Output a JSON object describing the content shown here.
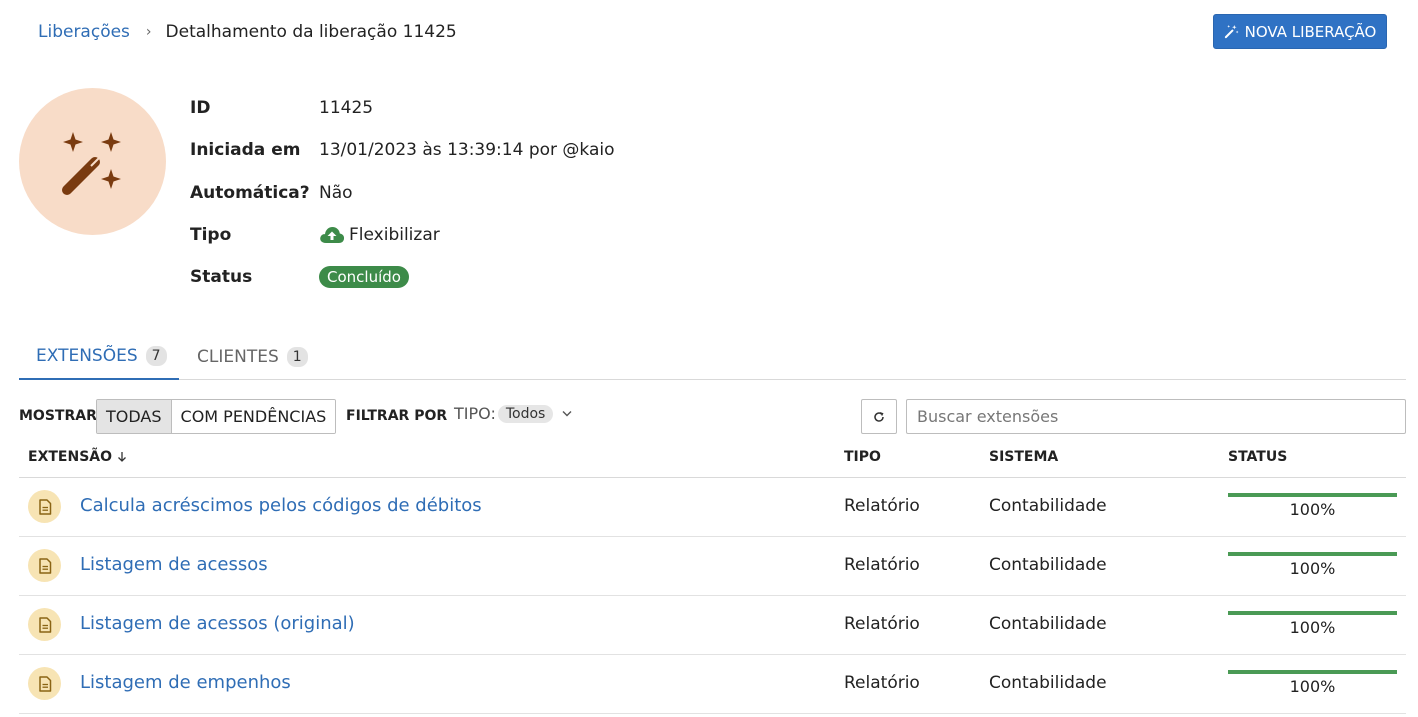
{
  "breadcrumb": {
    "parent": "Liberações",
    "separator": "›",
    "current": "Detalhamento da liberação 11425"
  },
  "actions": {
    "new_button": "NOVA LIBERAÇÃO"
  },
  "details": {
    "id_label": "ID",
    "id_value": "11425",
    "started_label": "Iniciada em",
    "started_value": "13/01/2023 às 13:39:14 por @kaio",
    "automatic_label": "Automática?",
    "automatic_value": "Não",
    "type_label": "Tipo",
    "type_value": "Flexibilizar",
    "status_label": "Status",
    "status_value": "Concluído"
  },
  "tabs": [
    {
      "label": "EXTENSÕES",
      "count": "7"
    },
    {
      "label": "CLIENTES",
      "count": "1"
    }
  ],
  "toolbar": {
    "show_label": "MOSTRAR",
    "show_all": "TODAS",
    "show_pending": "COM PENDÊNCIAS",
    "filter_label": "FILTRAR POR",
    "type_filter_label": "TIPO:",
    "type_filter_value": "Todos",
    "search_placeholder": "Buscar extensões"
  },
  "table": {
    "columns": {
      "extension": "EXTENSÃO",
      "type": "TIPO",
      "system": "SISTEMA",
      "status": "STATUS"
    },
    "rows": [
      {
        "name": "Calcula acréscimos pelos códigos de débitos",
        "type": "Relatório",
        "system": "Contabilidade",
        "progress": 100,
        "progress_text": "100%"
      },
      {
        "name": "Listagem de acessos",
        "type": "Relatório",
        "system": "Contabilidade",
        "progress": 100,
        "progress_text": "100%"
      },
      {
        "name": "Listagem de acessos (original)",
        "type": "Relatório",
        "system": "Contabilidade",
        "progress": 100,
        "progress_text": "100%"
      },
      {
        "name": "Listagem de empenhos",
        "type": "Relatório",
        "system": "Contabilidade",
        "progress": 100,
        "progress_text": "100%"
      }
    ]
  },
  "colors": {
    "link": "#2f6db5",
    "primary_button": "#2f72c4",
    "success": "#3d8b49",
    "avatar_bg": "#f8dcc8",
    "doc_icon_bg": "#f7e4b4"
  },
  "icons": {
    "new_button": "magic-wand-icon",
    "avatar": "magic-wand-sparkles-icon",
    "type": "cloud-upload-icon",
    "sort": "arrow-down-icon",
    "filter_dropdown": "chevron-down-icon",
    "refresh": "refresh-icon",
    "row": "document-icon"
  }
}
